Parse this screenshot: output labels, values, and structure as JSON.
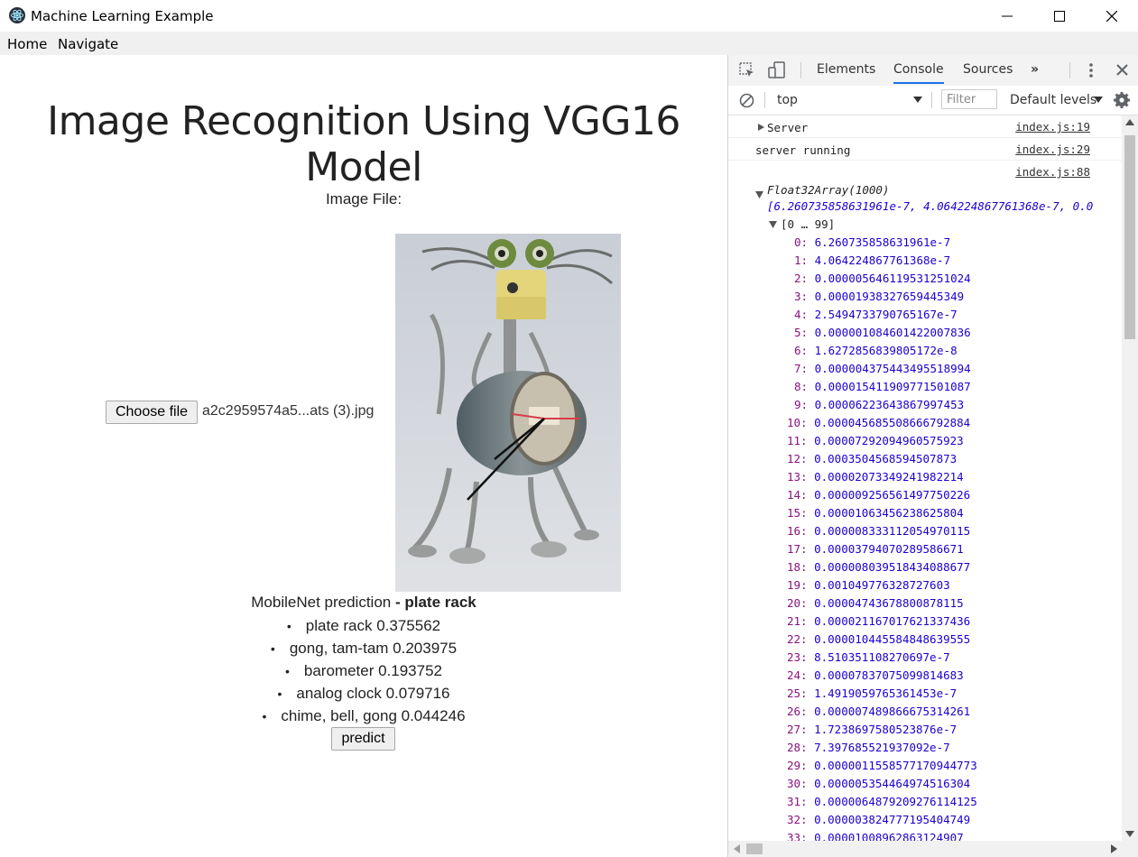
{
  "window": {
    "title": "Machine Learning Example"
  },
  "menu": {
    "items": [
      "Home",
      "Navigate"
    ]
  },
  "page": {
    "heading": "Image Recognition Using VGG16 Model",
    "image_file_label": "Image File:",
    "choose_file_label": "Choose file",
    "file_name": "a2c2959574a5...ats (3).jpg",
    "prediction_label": "MobileNet prediction",
    "prediction_top": "- plate rack",
    "predictions": [
      "plate rack 0.375562",
      "gong, tam-tam 0.203975",
      "barometer 0.193752",
      "analog clock 0.079716",
      "chime, bell, gong 0.044246"
    ],
    "predict_label": "predict"
  },
  "devtools": {
    "tabs": [
      "Elements",
      "Console",
      "Sources"
    ],
    "more": "»",
    "context": "top",
    "filter_placeholder": "Filter",
    "levels": "Default levels",
    "logs": [
      {
        "text": "Server",
        "source": "index.js:19"
      },
      {
        "text": "server running",
        "source": "index.js:29"
      },
      {
        "text": "",
        "source": "index.js:88"
      }
    ],
    "array_title": "Float32Array(1000)",
    "array_preview": "[6.260735858631961e-7, 4.064224867761368e-7, 0.0",
    "range_label": "[0 … 99]",
    "values": [
      "6.260735858631961e-7",
      "4.064224867761368e-7",
      "0.000005646119531251024",
      "0.00001938327659445349",
      "2.5494733790765167e-7",
      "0.000001084601422007836",
      "1.6272856839805172e-8",
      "0.000004375443495518994",
      "0.00001541190977150108​7",
      "0.00006223643867997453",
      "0.00004568550866679288​4",
      "0.00007292094960575923",
      "0.0003504568594507873",
      "0.00002073349241982214",
      "0.00000925656149775022​6",
      "0.00001063456238625804",
      "0.00000833311205497011​5",
      "0.00003794070289586671",
      "0.00000803951843408867​7",
      "0.001049776328727603",
      "0.00004743678800878115",
      "0.00002116701762133743​6",
      "0.00001044558484863955​5",
      "8.510351108270697e-7",
      "0.00007837075099814683",
      "1.4919059765361453e-7",
      "0.00000748986667531426​1",
      "1.7238697580523876e-7",
      "7.397685521937092e-7",
      "0.00000115585771709447​73",
      "0.00000535446497451630​4",
      "0.00000648792092761141​25",
      "0.00000382477719540474​9",
      "0.00001008962863124907"
    ]
  }
}
